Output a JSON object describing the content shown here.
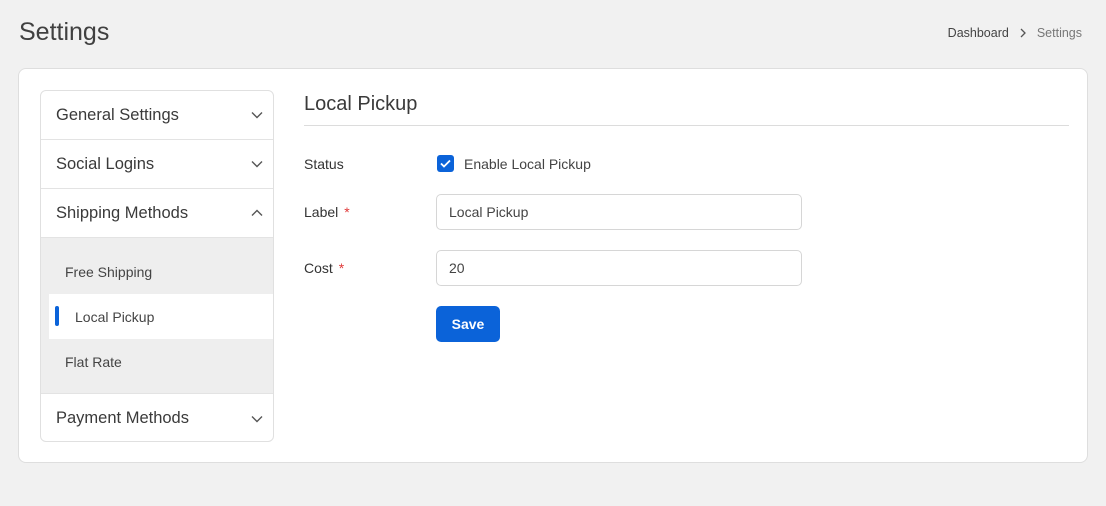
{
  "header": {
    "title": "Settings",
    "breadcrumb": {
      "home": "Dashboard",
      "current": "Settings"
    }
  },
  "sidebar": {
    "general": "General Settings",
    "social": "Social Logins",
    "shipping": {
      "label": "Shipping Methods",
      "items": [
        "Free Shipping",
        "Local Pickup",
        "Flat Rate"
      ],
      "active_item": "Local Pickup"
    },
    "payment": "Payment Methods"
  },
  "form": {
    "title": "Local Pickup",
    "status_label": "Status",
    "enable_label": "Enable Local Pickup",
    "enabled": true,
    "label_label": "Label",
    "label_value": "Local Pickup",
    "cost_label": "Cost",
    "cost_value": "20",
    "required_mark": "*",
    "save_label": "Save"
  },
  "colors": {
    "accent": "#0b63d9",
    "required": "#e03a3a",
    "background": "#f1f1f1"
  }
}
